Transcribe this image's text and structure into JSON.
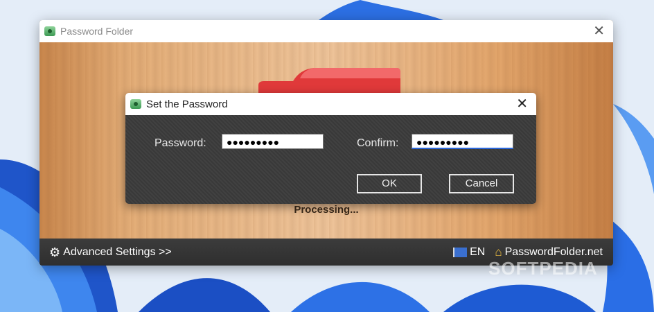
{
  "main_window": {
    "title": "Password Folder",
    "status": "Processing...",
    "bottom_bar": {
      "advanced_settings": "Advanced Settings >>",
      "language": "EN",
      "website": "PasswordFolder.net"
    }
  },
  "dialog": {
    "title": "Set the Password",
    "password_label": "Password:",
    "password_value": "●●●●●●●●●",
    "confirm_label": "Confirm:",
    "confirm_value": "●●●●●●●●●",
    "ok_label": "OK",
    "cancel_label": "Cancel"
  },
  "watermark": "SOFTPEDIA",
  "colors": {
    "wood": "#e3ad77",
    "dialog_body": "#3b3b3b",
    "folder_red": "#e0393a",
    "focus_accent": "#2a66d8"
  },
  "icons": {
    "app": "green-camera-icon",
    "close": "close-icon",
    "gear": "gear-icon",
    "flag": "flag-icon",
    "home": "home-icon"
  }
}
